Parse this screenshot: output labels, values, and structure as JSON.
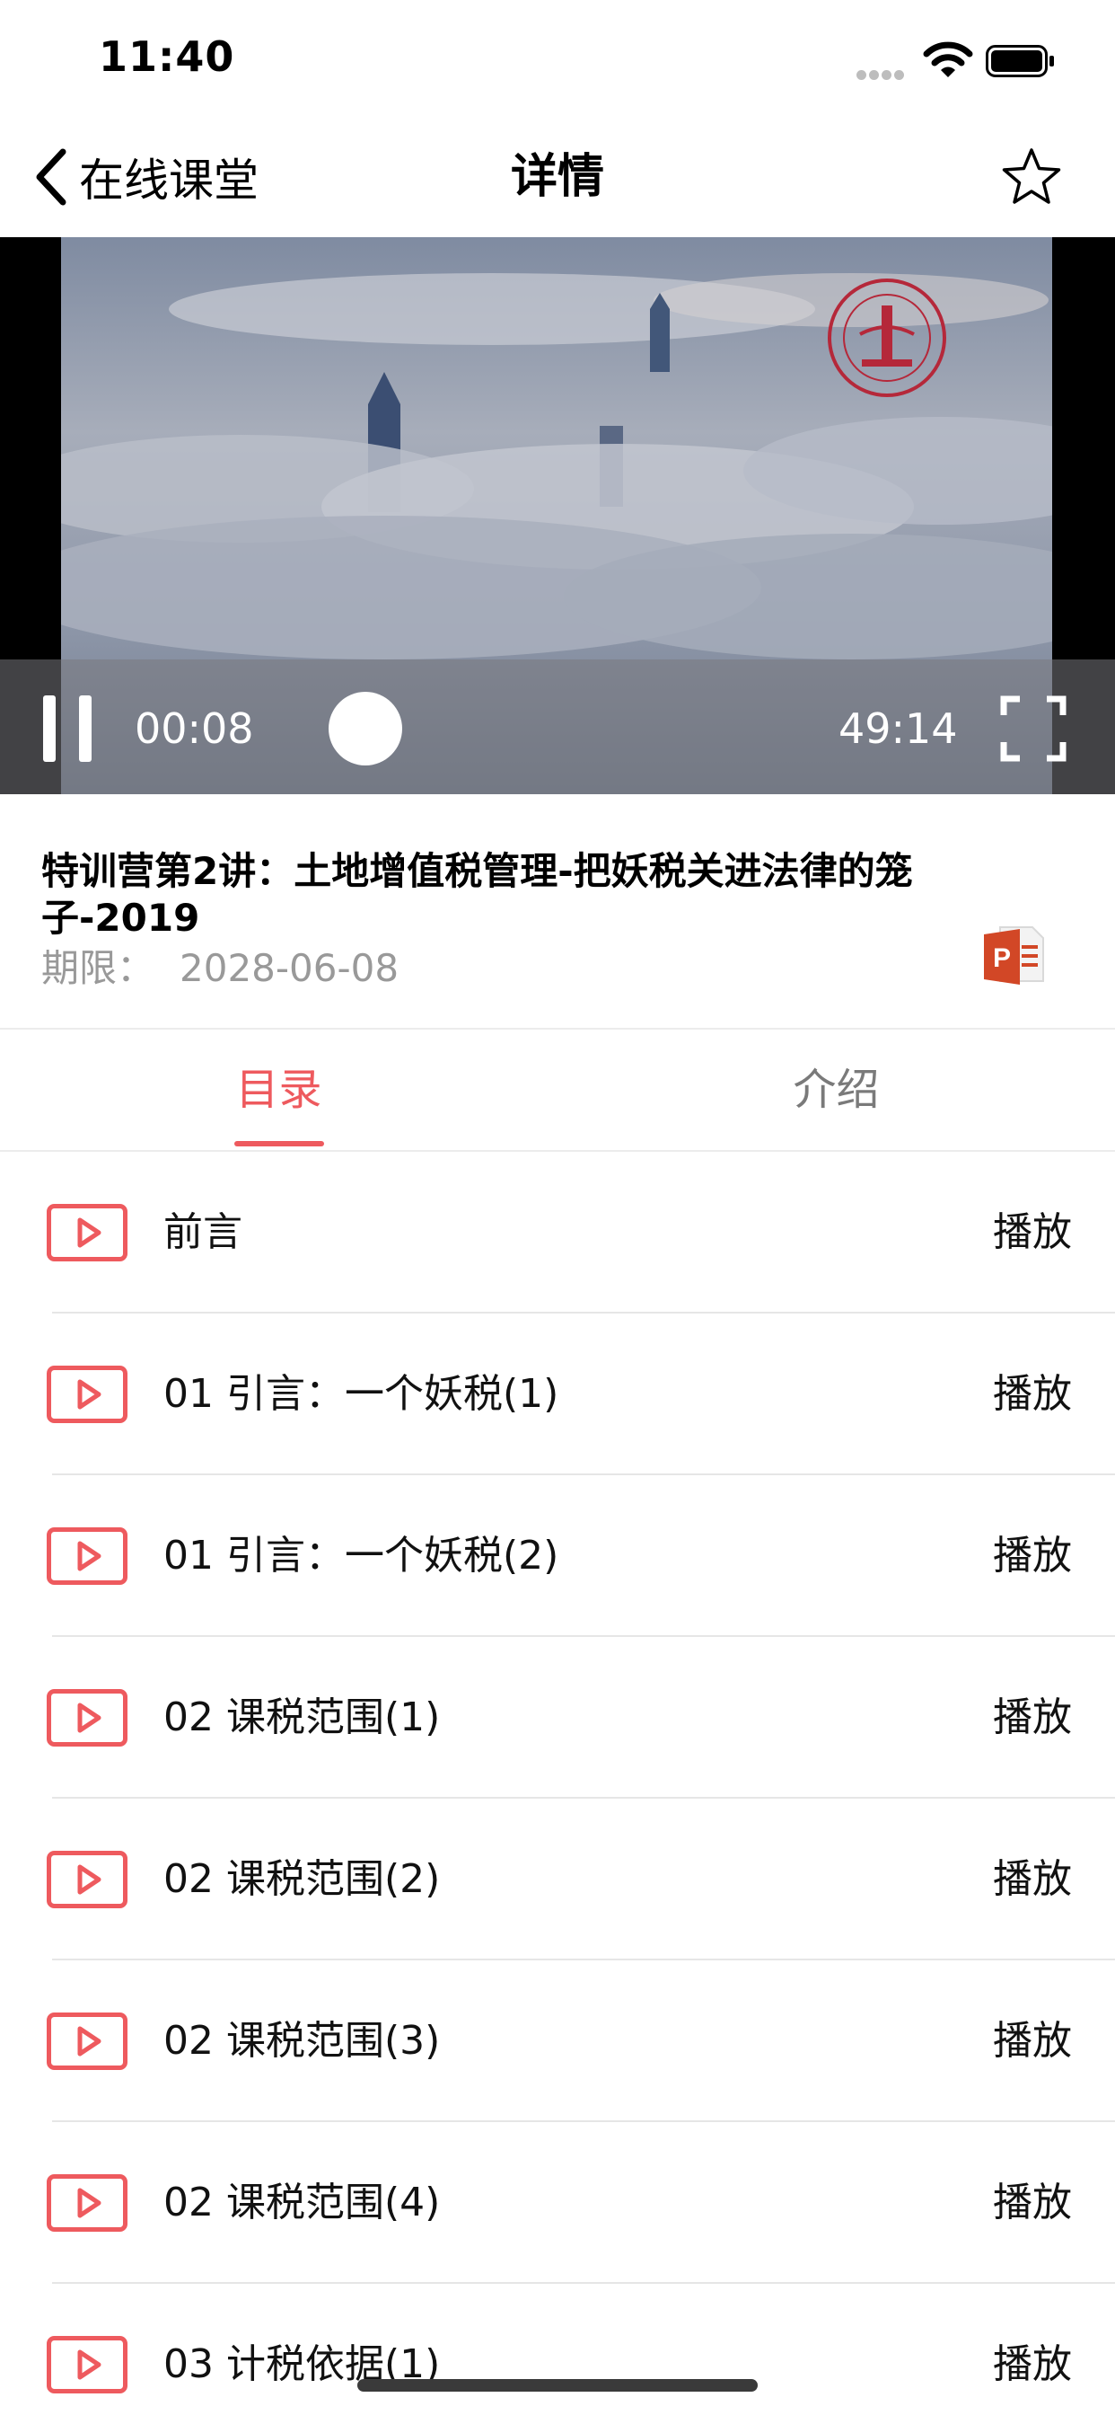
{
  "status_bar": {
    "time": "11:40"
  },
  "nav": {
    "back_label": "在线课堂",
    "title": "详情"
  },
  "video": {
    "current_time": "00:08",
    "total_time": "49:14",
    "progress": 0.003
  },
  "course": {
    "title": "特训营第2讲：土地增值税管理-把妖税关进法律的笼子-2019",
    "expiry_label": "期限：",
    "expiry_value": "2028-06-08"
  },
  "tabs": [
    {
      "label": "目录",
      "active": true
    },
    {
      "label": "介绍",
      "active": false
    }
  ],
  "lessons": [
    {
      "title": "前言",
      "action": "播放"
    },
    {
      "title": "01 引言：一个妖税(1)",
      "action": "播放"
    },
    {
      "title": "01 引言：一个妖税(2)",
      "action": "播放"
    },
    {
      "title": "02 课税范围(1)",
      "action": "播放"
    },
    {
      "title": "02 课税范围(2)",
      "action": "播放"
    },
    {
      "title": "02 课税范围(3)",
      "action": "播放"
    },
    {
      "title": "02 课税范围(4)",
      "action": "播放"
    },
    {
      "title": "03 计税依据(1)",
      "action": "播放"
    }
  ],
  "colors": {
    "accent": "#ee5a5e",
    "muted_text": "#999999",
    "divider": "#e6e6e6"
  },
  "icons": {
    "back": "chevron-left-icon",
    "favorite": "star-icon",
    "pause": "pause-icon",
    "fullscreen": "fullscreen-icon",
    "ppt": "powerpoint-icon",
    "lesson": "play-icon"
  }
}
